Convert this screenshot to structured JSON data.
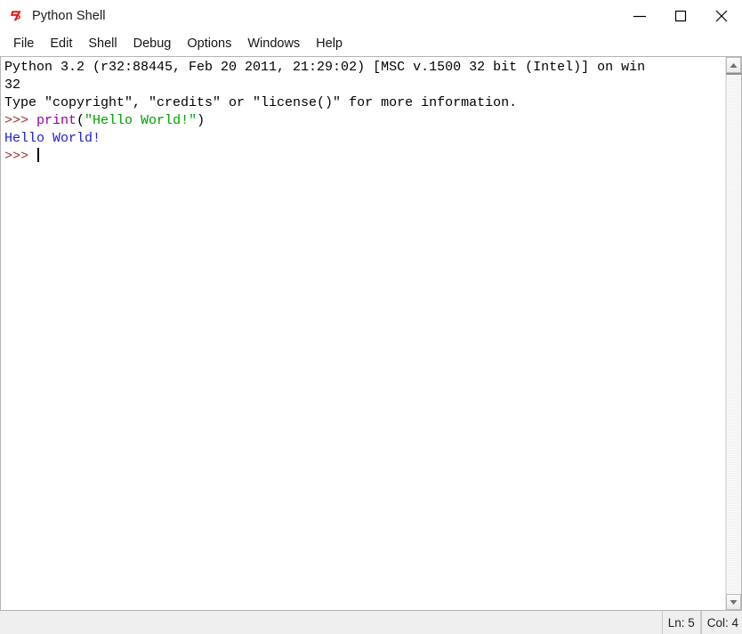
{
  "window": {
    "title": "Python Shell",
    "icon": "python-idle-icon",
    "controls": {
      "minimize": "minimize-icon",
      "maximize": "maximize-icon",
      "close": "close-icon"
    }
  },
  "menubar": {
    "items": [
      {
        "label": "File"
      },
      {
        "label": "Edit"
      },
      {
        "label": "Shell"
      },
      {
        "label": "Debug"
      },
      {
        "label": "Options"
      },
      {
        "label": "Windows"
      },
      {
        "label": "Help"
      }
    ]
  },
  "console": {
    "lines": [
      {
        "segments": [
          {
            "text": "Python 3.2 (r32:88445, Feb 20 2011, 21:29:02) [MSC v.1500 32 bit (Intel)] on win",
            "style": "plain"
          }
        ]
      },
      {
        "segments": [
          {
            "text": "32",
            "style": "plain"
          }
        ]
      },
      {
        "segments": [
          {
            "text": "Type \"copyright\", \"credits\" or \"license()\" for more information.",
            "style": "plain"
          }
        ]
      },
      {
        "segments": [
          {
            "text": ">>> ",
            "style": "prompt"
          },
          {
            "text": "print",
            "style": "builtin"
          },
          {
            "text": "(",
            "style": "plain"
          },
          {
            "text": "\"Hello World!\"",
            "style": "string"
          },
          {
            "text": ")",
            "style": "plain"
          }
        ]
      },
      {
        "segments": [
          {
            "text": "Hello World!",
            "style": "output"
          }
        ]
      },
      {
        "segments": [
          {
            "text": ">>> ",
            "style": "prompt"
          }
        ],
        "caret": true
      }
    ],
    "colors": {
      "plain": "#000000",
      "prompt": "#a0342c",
      "builtin": "#9400a0",
      "string": "#00a000",
      "output": "#2020d0",
      "background": "#ffffff"
    }
  },
  "scrollbar": {
    "up_arrow": "scroll-up-icon",
    "down_arrow": "scroll-down-icon"
  },
  "statusbar": {
    "line_label": "Ln: 5",
    "column_label": "Col: 4"
  }
}
